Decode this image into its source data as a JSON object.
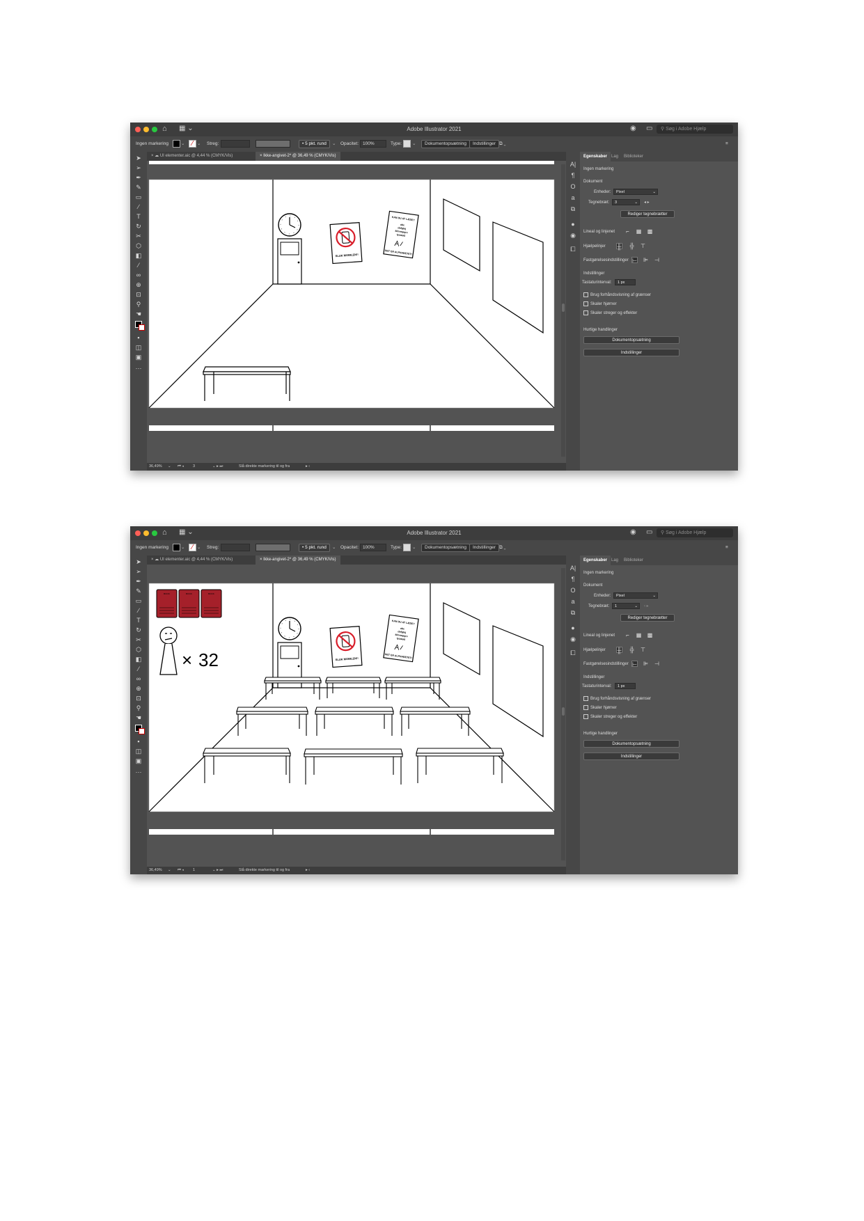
{
  "app": {
    "title": "Adobe Illustrator 2021",
    "help_search_placeholder": "Søg i Adobe Hjælp"
  },
  "control_bar": {
    "selection": "Ingen markering",
    "stroke_label": "Streg:",
    "brush": "5 pkt. rund",
    "opacity_label": "Opacitet:",
    "opacity_value": "100%",
    "type_label": "Type:",
    "doc_setup": "Dokumentopsætning",
    "preferences": "Indstillinger"
  },
  "tabs": [
    {
      "label": "UI elementer.aic @ 4,44 % (CMYK/Vis)"
    },
    {
      "label": "Ikke-angivet-2* @ 36,49 % (CMYK/Vis)"
    }
  ],
  "status": {
    "zoom": "36,49%",
    "hint": "Slå direkte markering til og fra"
  },
  "panel": {
    "tab_properties": "Egenskaber",
    "tab_layers": "Lag",
    "tab_libraries": "Biblioteker",
    "no_selection": "Ingen markering",
    "document_heading": "Dokument",
    "units_label": "Enheder:",
    "units_value": "Pixel",
    "artboard_label": "Tegnebræt:",
    "edit_artboards": "Rediger tegnebrætter",
    "rulers_grids": "Lineal og linjenet",
    "guides": "Hjælpelinjer",
    "snap_options": "Fastgørelsesindstillinger",
    "preferences_heading": "Indstillinger",
    "keyboard_increment_label": "Tastaturinterval:",
    "keyboard_increment_value": "1 px",
    "check_preview_bounds": "Brug forhåndsvisning af grænser",
    "check_scale_corners": "Skaler hjørner",
    "check_scale_strokes": "Skaler streger og effekter",
    "quick_actions": "Hurtige handlinger",
    "btn_doc_setup": "Dokumentopsætning",
    "btn_preferences": "Indstillinger"
  },
  "windows": [
    {
      "artboard_number": "3",
      "status_page": "3"
    },
    {
      "artboard_number": "1",
      "status_page": "1"
    }
  ],
  "artwork": {
    "poster_no_phone": "SLUK MOBILEN!!",
    "poster_alphabet_top": "KAN DU AT LÆSE?",
    "poster_alphabet_mid1": "abc",
    "poster_alphabet_mid2": "defghij",
    "poster_alphabet_mid3": "klmnopqrs",
    "poster_alphabet_mid4": "tyzæøå",
    "poster_alphabet_bottom": "DET ER ALPHABETET!",
    "student_count": "32",
    "multiply_sign": "×",
    "book_titles": [
      "BOOK",
      "BOOK",
      "BOOK"
    ]
  },
  "colors": {
    "window_bg": "#535353",
    "book_red": "#a5202a",
    "no_sign_red": "#d81e2a"
  }
}
